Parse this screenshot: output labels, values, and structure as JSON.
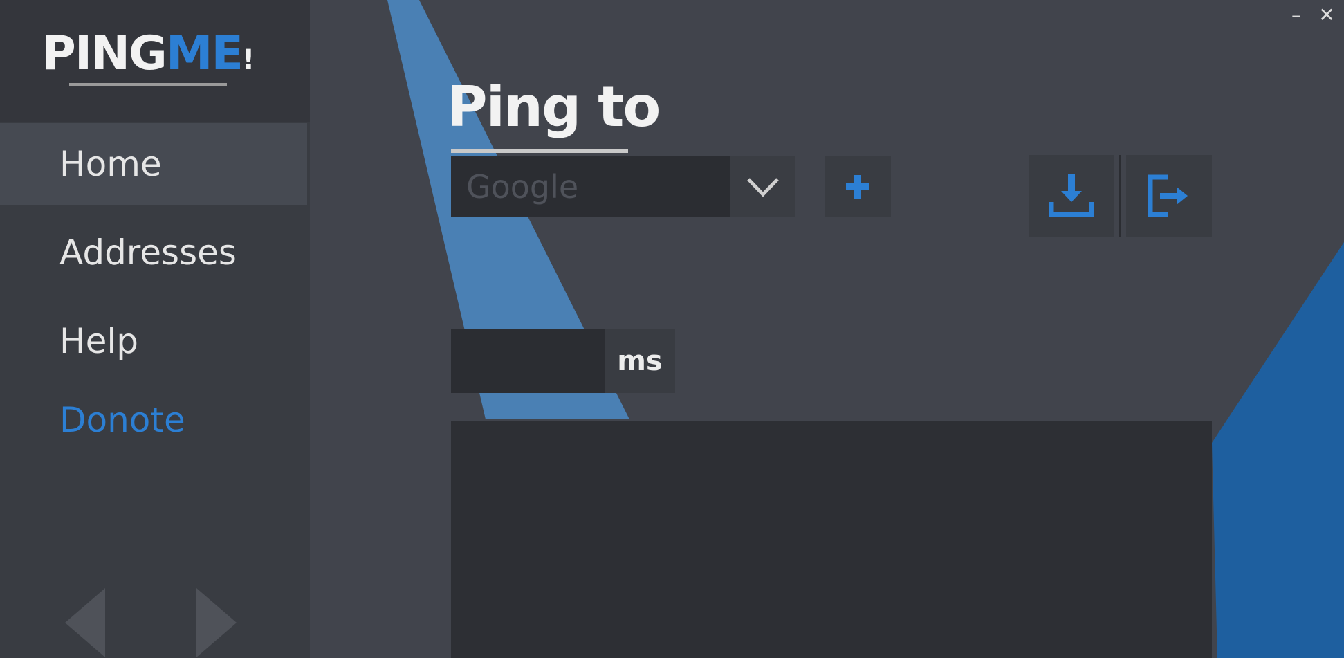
{
  "app": {
    "logo_ping": "PING",
    "logo_me": "ME",
    "logo_bang": "!"
  },
  "window": {
    "minimize_label": "–",
    "close_label": "✕"
  },
  "sidebar": {
    "items": [
      {
        "label": "Home",
        "active": true
      },
      {
        "label": "Addresses",
        "active": false
      },
      {
        "label": "Help",
        "active": false
      },
      {
        "label": "Donote",
        "active": false
      }
    ]
  },
  "main": {
    "title": "Ping to",
    "target_combo_value": "Google",
    "ms_unit": "ms",
    "ms_value": "",
    "output_text": ""
  },
  "icons": {
    "combo_dropdown": "chevron-down-icon",
    "add": "plus-icon",
    "download": "download-icon",
    "logout": "logout-icon",
    "back": "arrow-left-icon",
    "forward": "arrow-right-icon"
  },
  "colors": {
    "accent": "#2c7fd4",
    "stripe_light": "#4a80b4",
    "stripe_dark": "#1e5f9f",
    "background": "#41444c",
    "sidebar": "#393c42",
    "input_bg": "#2b2d32"
  }
}
